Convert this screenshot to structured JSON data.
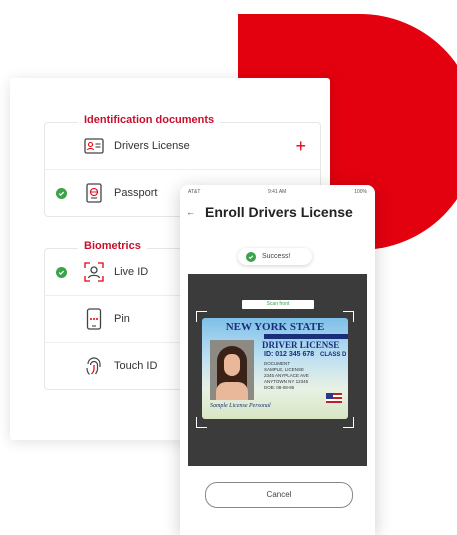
{
  "colors": {
    "brand_red": "#e3000f",
    "section_title": "#c8102e",
    "success_green": "#3ca34a",
    "license_blue": "#1a2e7a"
  },
  "identification": {
    "title": "Identification documents",
    "items": [
      {
        "label": "Drivers License",
        "icon": "id-card-icon",
        "verified": false,
        "action": "+"
      },
      {
        "label": "Passport",
        "icon": "passport-icon",
        "verified": true
      }
    ]
  },
  "biometrics": {
    "title": "Biometrics",
    "items": [
      {
        "label": "Live ID",
        "icon": "face-scan-icon",
        "verified": true
      },
      {
        "label": "Pin",
        "icon": "pin-phone-icon",
        "verified": false
      },
      {
        "label": "Touch ID",
        "icon": "fingerprint-icon",
        "verified": false
      }
    ]
  },
  "phone": {
    "status_left": "AT&T",
    "status_time": "9:41 AM",
    "status_right": "100%",
    "back_glyph": "←",
    "title": "Enroll Drivers License",
    "success_text": "Success!",
    "scan_label": "Scan front",
    "cancel_label": "Cancel"
  },
  "license": {
    "state": "NEW YORK STATE",
    "type": "DRIVER LICENSE",
    "id": "ID: 012 345 678",
    "class": "CLASS D",
    "lines": [
      "DOCUMENT",
      "SAMPLE, LICENSE",
      "2345 ANYPLACE AVE",
      "ANYTOWN NY 12345",
      "DOB: 08-08-85"
    ],
    "signature": "Sample License Personal"
  }
}
